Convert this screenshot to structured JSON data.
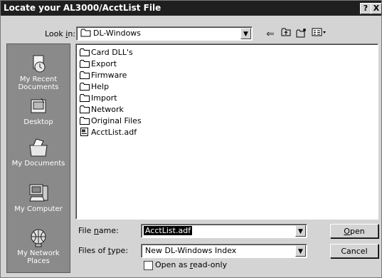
{
  "window": {
    "title": "Locate your AL3000/AcctList File",
    "help_glyph": "?",
    "close_glyph": "X"
  },
  "lookin": {
    "label_pre": "Look ",
    "label_key": "i",
    "label_post": "n:",
    "value": "DL-Windows"
  },
  "toolbar": {
    "back_icon": "back-arrow-icon",
    "up_icon": "up-folder-icon",
    "new_icon": "new-folder-icon",
    "view_icon": "view-menu-icon"
  },
  "places": [
    {
      "label": "My Recent\nDocuments",
      "icon": "recent-documents-icon"
    },
    {
      "label": "Desktop",
      "icon": "desktop-icon"
    },
    {
      "label": "My Documents",
      "icon": "my-documents-icon"
    },
    {
      "label": "My Computer",
      "icon": "my-computer-icon"
    },
    {
      "label": "My Network\nPlaces",
      "icon": "network-places-icon"
    }
  ],
  "files": [
    {
      "name": "Card DLL's",
      "type": "folder"
    },
    {
      "name": "Export",
      "type": "folder"
    },
    {
      "name": "Firmware",
      "type": "folder"
    },
    {
      "name": "Help",
      "type": "folder"
    },
    {
      "name": "Import",
      "type": "folder"
    },
    {
      "name": "Network",
      "type": "folder"
    },
    {
      "name": "Original Files",
      "type": "folder"
    },
    {
      "name": "AcctList.adf",
      "type": "file"
    }
  ],
  "filename": {
    "label_pre": "File ",
    "label_key": "n",
    "label_post": "ame:",
    "value": "AcctList.adf"
  },
  "filetype": {
    "label_pre": "Files of ",
    "label_key": "t",
    "label_post": "ype:",
    "value": "New DL-Windows Index"
  },
  "readonly": {
    "label_pre": "Open as ",
    "label_key": "r",
    "label_post": "ead-only",
    "checked": false
  },
  "buttons": {
    "open_key": "O",
    "open_rest": "pen",
    "cancel": "Cancel"
  }
}
